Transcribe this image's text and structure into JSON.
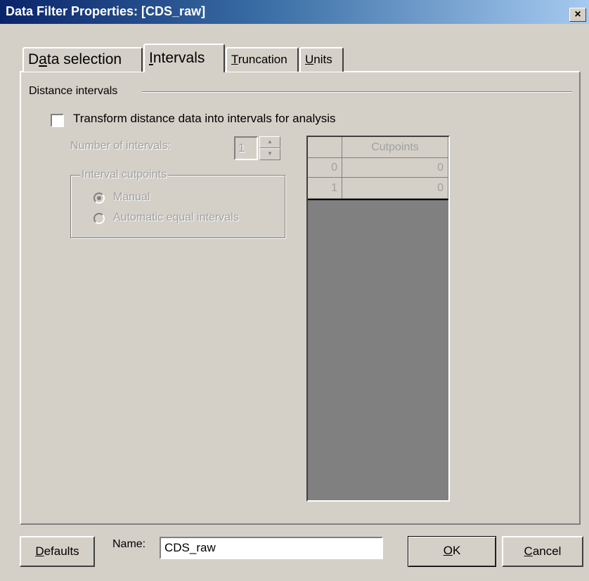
{
  "window": {
    "title": "Data Filter Properties: [CDS_raw]",
    "close_glyph": "×"
  },
  "tabs": [
    {
      "label_pre": "D",
      "label_ul": "a",
      "label_post": "ta selection"
    },
    {
      "label_pre": "",
      "label_ul": "I",
      "label_post": "ntervals"
    },
    {
      "label_pre": "",
      "label_ul": "T",
      "label_post": "runcation"
    },
    {
      "label_pre": "",
      "label_ul": "U",
      "label_post": "nits"
    }
  ],
  "active_tab": "Intervals",
  "section": {
    "title": "Distance intervals",
    "checkbox_label": "Transform distance data into intervals for analysis",
    "checkbox_checked": false
  },
  "intervals": {
    "number_label": "Number of intervals:",
    "number_value": "1",
    "spin_up": "▲",
    "spin_down": "▼"
  },
  "cutpoints_group": {
    "title": "Interval cutpoints",
    "options": [
      "Manual",
      "Automatic equal intervals"
    ],
    "selected": "Manual"
  },
  "grid": {
    "header": "Cutpoints",
    "rows": [
      {
        "index": "0",
        "value": "0"
      },
      {
        "index": "1",
        "value": "0"
      }
    ]
  },
  "footer": {
    "defaults_pre": "",
    "defaults_ul": "D",
    "defaults_post": "efaults",
    "name_label": "Name:",
    "name_value": "CDS_raw",
    "ok_ul": "O",
    "ok_post": "K",
    "cancel_ul": "C",
    "cancel_post": "ancel"
  },
  "colors": {
    "dialog_bg": "#d4d0c8",
    "title_gradient_start": "#0a246a",
    "title_gradient_end": "#a6caf0",
    "disabled_text": "#a0a0a0",
    "grid_bg": "#808080"
  }
}
